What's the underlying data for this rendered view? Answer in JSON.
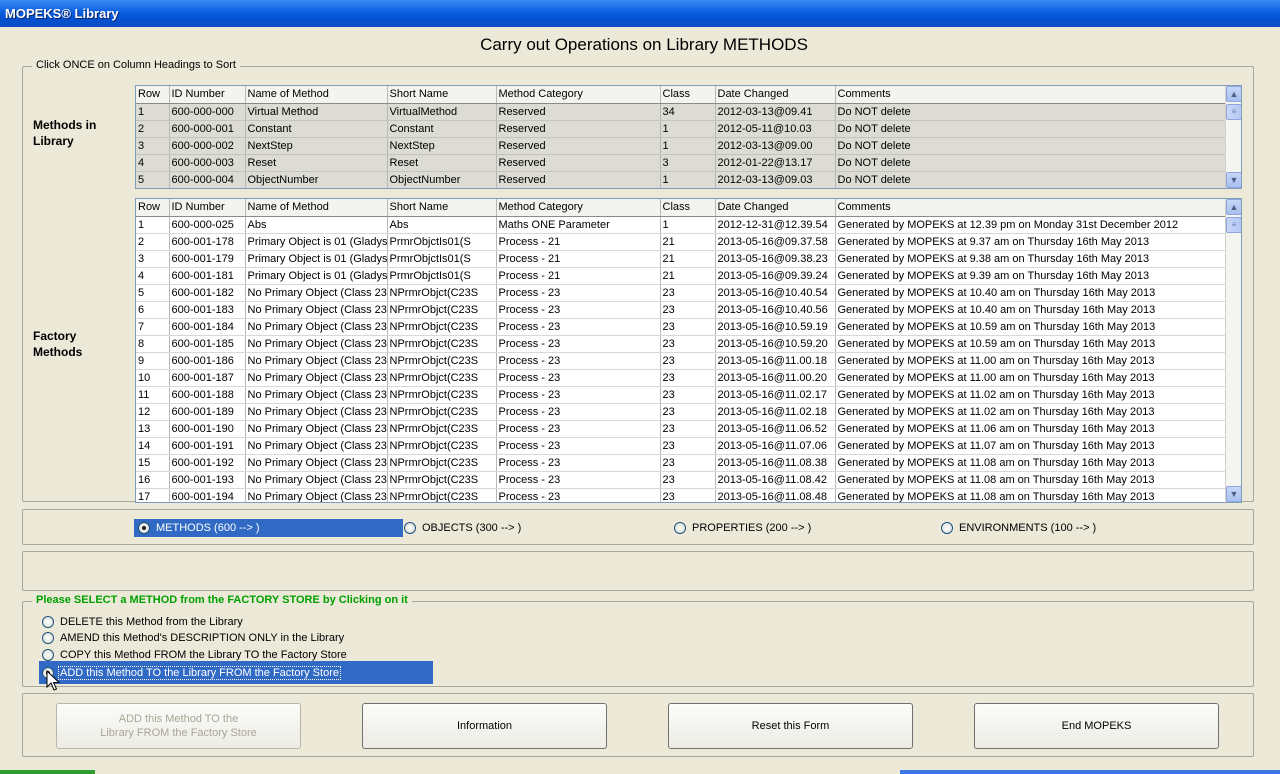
{
  "window": {
    "title": "MOPEKS® Library"
  },
  "page": {
    "title": "Carry out Operations on Library METHODS"
  },
  "sort_group": {
    "legend": "Click ONCE on Column Headings to Sort"
  },
  "library_grid": {
    "label": "Methods in\nLibrary",
    "columns": [
      "Row",
      "ID Number",
      "Name of Method",
      "Short Name",
      "Method Category",
      "Class",
      "Date Changed",
      "Comments"
    ],
    "rows": [
      [
        "1",
        "600-000-000",
        "Virtual Method",
        "VirtualMethod",
        "Reserved",
        "34",
        "2012-03-13@09.41",
        "Do NOT delete"
      ],
      [
        "2",
        "600-000-001",
        "Constant",
        "Constant",
        "Reserved",
        "1",
        "2012-05-11@10.03",
        "Do NOT delete"
      ],
      [
        "3",
        "600-000-002",
        "NextStep",
        "NextStep",
        "Reserved",
        "1",
        "2012-03-13@09.00",
        "Do NOT delete"
      ],
      [
        "4",
        "600-000-003",
        "Reset",
        "Reset",
        "Reserved",
        "3",
        "2012-01-22@13.17",
        "Do NOT delete"
      ],
      [
        "5",
        "600-000-004",
        "ObjectNumber",
        "ObjectNumber",
        "Reserved",
        "1",
        "2012-03-13@09.03",
        "Do NOT delete"
      ]
    ]
  },
  "factory_grid": {
    "label": "Factory\nMethods",
    "columns": [
      "Row",
      "ID Number",
      "Name of Method",
      "Short Name",
      "Method Category",
      "Class",
      "Date Changed",
      "Comments"
    ],
    "rows": [
      [
        "1",
        "600-000-025",
        "Abs",
        "Abs",
        "Maths ONE Parameter",
        "1",
        "2012-12-31@12.39.54",
        "Generated by MOPEKS at 12.39 pm on Monday 31st December 2012"
      ],
      [
        "2",
        "600-001-178",
        "Primary Object is 01 (Gladys",
        "PrmrObjctIs01(S",
        "Process - 21",
        "21",
        "2013-05-16@09.37.58",
        "Generated by MOPEKS at 9.37 am on Thursday 16th May 2013"
      ],
      [
        "3",
        "600-001-179",
        "Primary Object is 01 (Gladys",
        "PrmrObjctIs01(S",
        "Process - 21",
        "21",
        "2013-05-16@09.38.23",
        "Generated by MOPEKS at 9.38 am on Thursday 16th May 2013"
      ],
      [
        "4",
        "600-001-181",
        "Primary Object is 01 (Gladys",
        "PrmrObjctIs01(S",
        "Process - 21",
        "21",
        "2013-05-16@09.39.24",
        "Generated by MOPEKS at 9.39 am on Thursday 16th May 2013"
      ],
      [
        "5",
        "600-001-182",
        "No Primary Object (Class 23",
        "NPrmrObjct(C23S",
        "Process - 23",
        "23",
        "2013-05-16@10.40.54",
        "Generated by MOPEKS at 10.40 am on Thursday 16th May 2013"
      ],
      [
        "6",
        "600-001-183",
        "No Primary Object (Class 23",
        "NPrmrObjct(C23S",
        "Process - 23",
        "23",
        "2013-05-16@10.40.56",
        "Generated by MOPEKS at 10.40 am on Thursday 16th May 2013"
      ],
      [
        "7",
        "600-001-184",
        "No Primary Object (Class 23",
        "NPrmrObjct(C23S",
        "Process - 23",
        "23",
        "2013-05-16@10.59.19",
        "Generated by MOPEKS at 10.59 am on Thursday 16th May 2013"
      ],
      [
        "8",
        "600-001-185",
        "No Primary Object (Class 23",
        "NPrmrObjct(C23S",
        "Process - 23",
        "23",
        "2013-05-16@10.59.20",
        "Generated by MOPEKS at 10.59 am on Thursday 16th May 2013"
      ],
      [
        "9",
        "600-001-186",
        "No Primary Object (Class 23",
        "NPrmrObjct(C23S",
        "Process - 23",
        "23",
        "2013-05-16@11.00.18",
        "Generated by MOPEKS at 11.00 am on Thursday 16th May 2013"
      ],
      [
        "10",
        "600-001-187",
        "No Primary Object (Class 23",
        "NPrmrObjct(C23S",
        "Process - 23",
        "23",
        "2013-05-16@11.00.20",
        "Generated by MOPEKS at 11.00 am on Thursday 16th May 2013"
      ],
      [
        "11",
        "600-001-188",
        "No Primary Object (Class 23",
        "NPrmrObjct(C23S",
        "Process - 23",
        "23",
        "2013-05-16@11.02.17",
        "Generated by MOPEKS at 11.02 am on Thursday 16th May 2013"
      ],
      [
        "12",
        "600-001-189",
        "No Primary Object (Class 23",
        "NPrmrObjct(C23S",
        "Process - 23",
        "23",
        "2013-05-16@11.02.18",
        "Generated by MOPEKS at 11.02 am on Thursday 16th May 2013"
      ],
      [
        "13",
        "600-001-190",
        "No Primary Object (Class 23",
        "NPrmrObjct(C23S",
        "Process - 23",
        "23",
        "2013-05-16@11.06.52",
        "Generated by MOPEKS at 11.06 am on Thursday 16th May 2013"
      ],
      [
        "14",
        "600-001-191",
        "No Primary Object (Class 23",
        "NPrmrObjct(C23S",
        "Process - 23",
        "23",
        "2013-05-16@11.07.06",
        "Generated by MOPEKS at 11.07 am on Thursday 16th May 2013"
      ],
      [
        "15",
        "600-001-192",
        "No Primary Object (Class 23",
        "NPrmrObjct(C23S",
        "Process - 23",
        "23",
        "2013-05-16@11.08.38",
        "Generated by MOPEKS at 11.08 am on Thursday 16th May 2013"
      ],
      [
        "16",
        "600-001-193",
        "No Primary Object (Class 23",
        "NPrmrObjct(C23S",
        "Process - 23",
        "23",
        "2013-05-16@11.08.42",
        "Generated by MOPEKS at 11.08 am on Thursday 16th May 2013"
      ],
      [
        "17",
        "600-001-194",
        "No Primary Object (Class 23",
        "NPrmrObjct(C23S",
        "Process - 23",
        "23",
        "2013-05-16@11.08.48",
        "Generated by MOPEKS at 11.08 am on Thursday 16th May 2013"
      ]
    ]
  },
  "type_options": {
    "methods": "METHODS (600 --> )",
    "objects": "OBJECTS (300 --> )",
    "properties": "PROPERTIES (200 --> )",
    "environments": "ENVIRONMENTS (100 --> )",
    "selected": "methods"
  },
  "operations": {
    "legend": "Please SELECT a METHOD from the FACTORY STORE by Clicking on it",
    "delete": "DELETE this Method from the Library",
    "amend": "AMEND this Method's DESCRIPTION ONLY in the Library",
    "copy": "COPY this Method FROM the Library TO the Factory Store",
    "add": "ADD this Method TO the Library FROM the Factory Store",
    "selected": "add"
  },
  "buttons": {
    "action_line1": "ADD this Method TO the",
    "action_line2": "Library FROM the Factory Store",
    "information": "Information",
    "reset": "Reset this Form",
    "end": "End MOPEKS"
  },
  "colors": {
    "titlebar": "#0a5fe0",
    "selection": "#316ac5",
    "legend_green": "#00a000",
    "background": "#ece9d8"
  }
}
